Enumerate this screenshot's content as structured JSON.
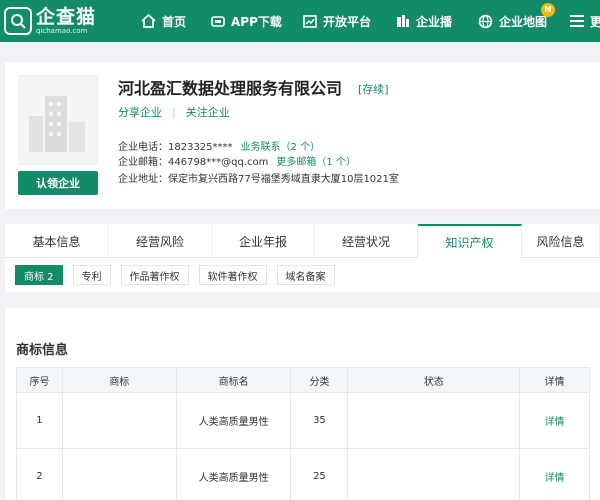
{
  "brand": {
    "name": "企查猫",
    "domain": "qichamao.com"
  },
  "nav": [
    {
      "label": "首页",
      "icon": "home-icon"
    },
    {
      "label": "APP下载",
      "icon": "app-icon"
    },
    {
      "label": "开放平台",
      "icon": "chart-icon"
    },
    {
      "label": "企业播",
      "icon": "buildings-icon"
    },
    {
      "label": "企业地图",
      "icon": "globe-icon",
      "badge": "N"
    },
    {
      "label": "更",
      "icon": "menu-icon"
    }
  ],
  "company": {
    "name": "河北盈汇数据处理服务有限公司",
    "status": "[存续]",
    "share": "分享企业",
    "follow": "关注企业",
    "claim": "认领企业",
    "phone_label": "企业电话：",
    "phone": "1823325****",
    "phone_link": "业务联系（2 个）",
    "email_label": "企业邮箱：",
    "email": "446798***@qq.com",
    "email_link": "更多邮箱（1 个）",
    "address_label": "企业地址：",
    "address": "保定市复兴西路77号福堡秀域直隶大厦10层1021室"
  },
  "tabs": [
    "基本信息",
    "经营风险",
    "企业年报",
    "经营状况",
    "知识产权",
    "风险信息"
  ],
  "subtabs": [
    "商标 2",
    "专利",
    "作品著作权",
    "软件著作权",
    "域名备案"
  ],
  "trademark": {
    "title": "商标信息",
    "columns": [
      "序号",
      "商标",
      "商标名",
      "分类",
      "状态",
      "详情"
    ],
    "rows": [
      {
        "no": "1",
        "logo": "",
        "name": "人类高质量男性",
        "class": "35",
        "status": "",
        "detail": "详情"
      },
      {
        "no": "2",
        "logo": "",
        "name": "人类高质量男性",
        "class": "25",
        "status": "",
        "detail": "详情"
      }
    ]
  },
  "colors": {
    "brand": "#128b68",
    "badge": "#f7b500"
  }
}
